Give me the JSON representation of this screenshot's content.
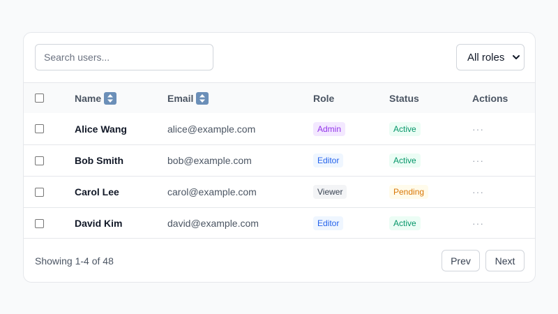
{
  "search": {
    "placeholder": "Search users...",
    "value": ""
  },
  "role_filter": {
    "selected": "All roles"
  },
  "table": {
    "headers": {
      "name": "Name",
      "email": "Email",
      "role": "Role",
      "status": "Status",
      "actions": "Actions"
    },
    "rows": [
      {
        "name": "Alice Wang",
        "email": "alice@example.com",
        "role": "Admin",
        "status": "Active",
        "actions": "···"
      },
      {
        "name": "Bob Smith",
        "email": "bob@example.com",
        "role": "Editor",
        "status": "Active",
        "actions": "···"
      },
      {
        "name": "Carol Lee",
        "email": "carol@example.com",
        "role": "Viewer",
        "status": "Pending",
        "actions": "···"
      },
      {
        "name": "David Kim",
        "email": "david@example.com",
        "role": "Editor",
        "status": "Active",
        "actions": "···"
      }
    ]
  },
  "footer": {
    "showing": "Showing 1-4 of 48",
    "prev_label": "Prev",
    "next_label": "Next"
  },
  "colors": {
    "admin_bg": "#f3e8ff",
    "admin_fg": "#9333ea",
    "editor_bg": "#eff6ff",
    "editor_fg": "#2563eb",
    "viewer_bg": "#f3f4f6",
    "viewer_fg": "#374151",
    "active_bg": "#ecfdf5",
    "active_fg": "#059669",
    "pending_bg": "#fffbeb",
    "pending_fg": "#d97706"
  }
}
